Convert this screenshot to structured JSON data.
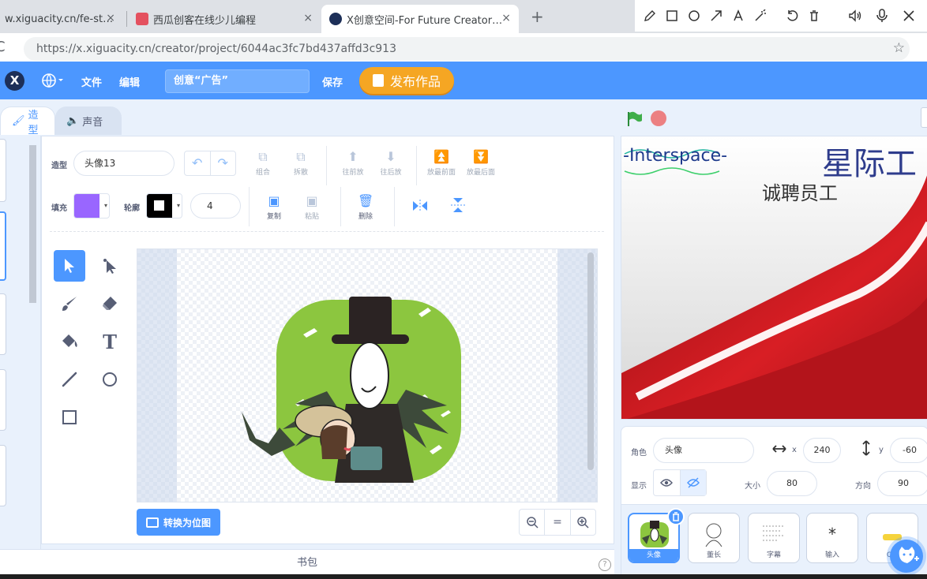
{
  "browser": {
    "tabs": [
      {
        "title": "w.xiguacity.cn/fe-st…",
        "close": "×"
      },
      {
        "title": "西瓜创客在线少儿编程",
        "close": "×"
      },
      {
        "title": "X创意空间-For Future Creator…",
        "close": "×"
      }
    ],
    "new_tab": "+",
    "url": "https://x.xiguacity.cn/creator/project/6044ac3fc7bd437affd3c913"
  },
  "header": {
    "menu_file": "文件",
    "menu_edit": "编辑",
    "project_title": "创意“广告”",
    "save": "保存",
    "publish": "发布作品"
  },
  "editor": {
    "tabs": {
      "costumes": "造型",
      "sounds": "声音"
    },
    "costume_label": "造型",
    "costume_name": "头像13",
    "buttons": {
      "group": "组合",
      "ungroup": "拆散",
      "forward": "往前放",
      "backward": "往后放",
      "front": "放最前面",
      "back": "放最后面",
      "copy": "复制",
      "paste": "粘贴",
      "delete": "删除"
    },
    "fill_label": "填充",
    "outline_label": "轮廓",
    "fill_color": "#9966ff",
    "outline_color": "#000000",
    "stroke_width": "4",
    "convert_bitmap": "转换为位图",
    "zoom_reset": "="
  },
  "backpack": {
    "label": "书包",
    "help": "?"
  },
  "stage": {
    "logo_text": "-Interspace-",
    "heading": "星际工",
    "subheading": "诚聘员工"
  },
  "sprite_info": {
    "sprite_label": "角色",
    "sprite_name": "头像",
    "x_label": "x",
    "x": "240",
    "y_label": "y",
    "y": "-60",
    "show_label": "显示",
    "size_label": "大小",
    "size": "80",
    "direction_label": "方向",
    "direction": "90"
  },
  "sprites": [
    {
      "name": "头像"
    },
    {
      "name": "董长"
    },
    {
      "name": "字幕"
    },
    {
      "name": "输入"
    },
    {
      "name": "QQ"
    }
  ],
  "colors": {
    "accent": "#4c97ff",
    "publish": "#f5a623",
    "stage_red": "#c8131b"
  }
}
